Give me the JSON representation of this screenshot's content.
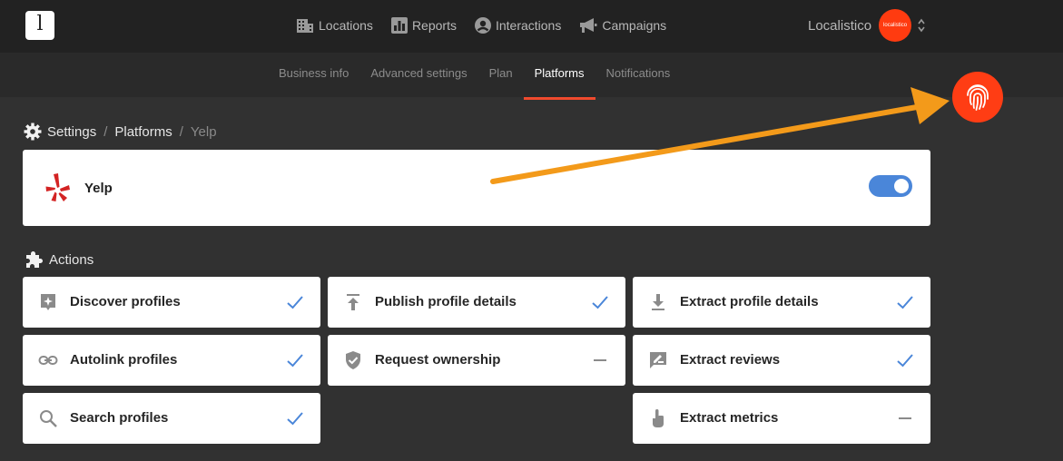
{
  "brand": {
    "logo_letter": "l",
    "accent": "#f04a2d",
    "toggle_color": "#4a86d9",
    "yelp_red": "#d32323"
  },
  "main_nav": [
    {
      "label": "Locations",
      "icon": "building-icon"
    },
    {
      "label": "Reports",
      "icon": "bar-chart-icon"
    },
    {
      "label": "Interactions",
      "icon": "user-circle-icon"
    },
    {
      "label": "Campaigns",
      "icon": "megaphone-icon"
    }
  ],
  "account": {
    "name": "Localistico",
    "avatar_text": "localistico"
  },
  "sub_nav": [
    {
      "label": "Business info",
      "active": false
    },
    {
      "label": "Advanced settings",
      "active": false
    },
    {
      "label": "Plan",
      "active": false
    },
    {
      "label": "Platforms",
      "active": true
    },
    {
      "label": "Notifications",
      "active": false
    }
  ],
  "breadcrumb": {
    "items": [
      "Settings",
      "Platforms",
      "Yelp"
    ],
    "separator": "/"
  },
  "platform": {
    "name": "Yelp",
    "enabled": true
  },
  "actions_heading": "Actions",
  "actions": [
    {
      "label": "Discover profiles",
      "icon": "sparkle-card-icon",
      "status": "check"
    },
    {
      "label": "Publish profile details",
      "icon": "upload-icon",
      "status": "check"
    },
    {
      "label": "Extract profile details",
      "icon": "download-icon",
      "status": "check"
    },
    {
      "label": "Autolink profiles",
      "icon": "link-icon",
      "status": "check"
    },
    {
      "label": "Request ownership",
      "icon": "shield-check-icon",
      "status": "dash"
    },
    {
      "label": "Extract reviews",
      "icon": "review-icon",
      "status": "check"
    },
    {
      "label": "Search profiles",
      "icon": "search-icon",
      "status": "check"
    },
    {
      "label": "Extract metrics",
      "icon": "touch-icon",
      "status": "dash"
    }
  ]
}
